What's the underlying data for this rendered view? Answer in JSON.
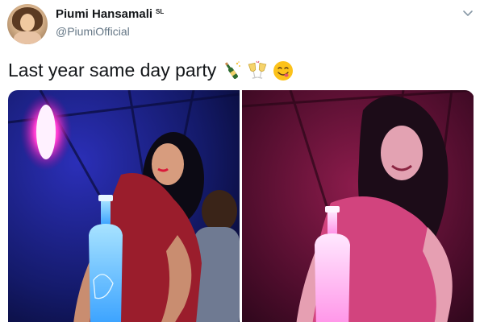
{
  "tweet": {
    "display_name": "Piumi Hansamali",
    "flag_badge": "SL",
    "handle": "@PiumiOfficial",
    "text": "Last year same day party",
    "emojis": [
      "bottle-with-popping-cork-emoji",
      "clinking-glasses-emoji",
      "face-savoring-food-emoji"
    ]
  },
  "media": {
    "photos": [
      {
        "description_icon": "party-photo-blue"
      },
      {
        "description_icon": "party-photo-pink"
      }
    ]
  },
  "colors": {
    "text_primary": "#14171a",
    "text_secondary": "#657786",
    "background": "#ffffff"
  },
  "icons": {
    "caret": "chevron-down-icon"
  }
}
